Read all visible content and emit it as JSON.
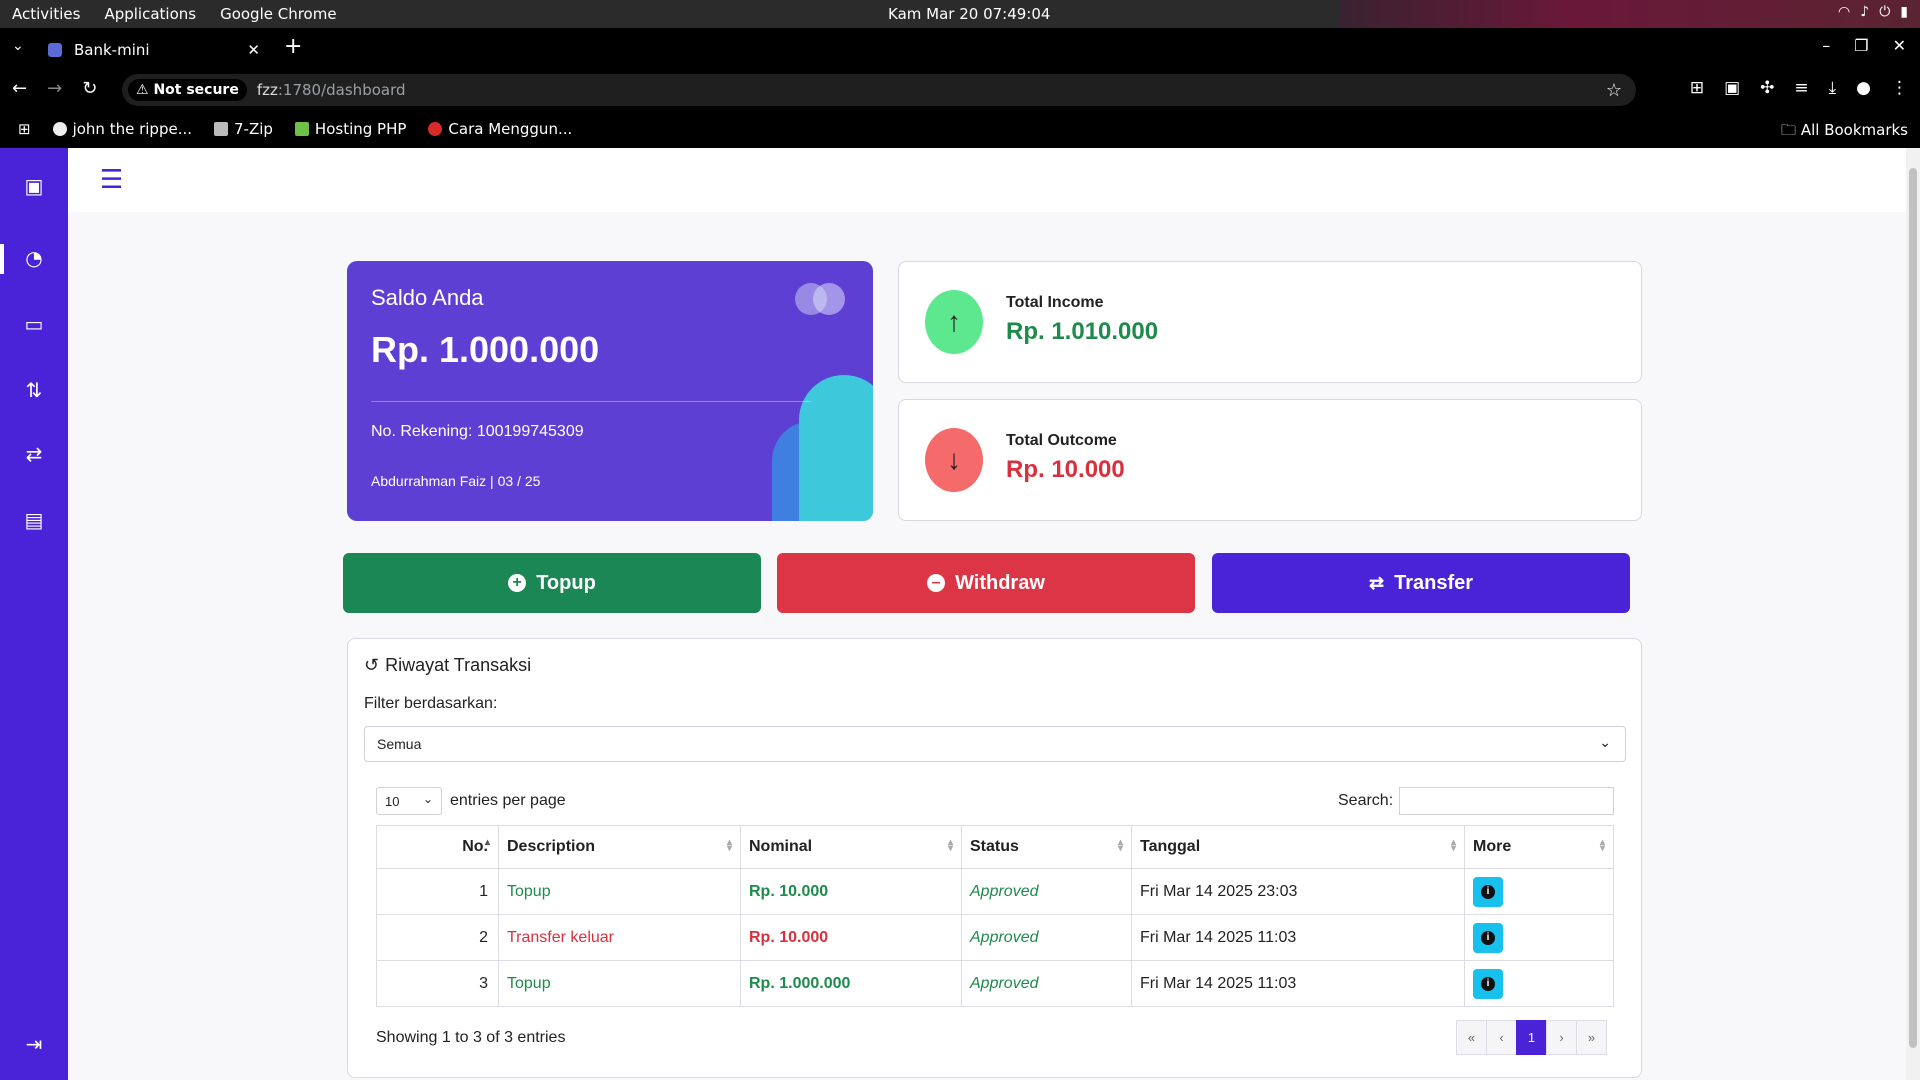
{
  "os": {
    "activities": "Activities",
    "applications": "Applications",
    "app_name": "Google Chrome",
    "clock": "Kam Mar 20  07:49:04"
  },
  "browser": {
    "tab_title": "Bank-mini",
    "not_secure": "Not secure",
    "url_host": "fzz",
    "url_rest": ":1780/dashboard",
    "bookmarks": [
      "john the rippe...",
      "7-Zip",
      "Hosting PHP",
      "Cara Menggun..."
    ],
    "all_bookmarks": "All Bookmarks"
  },
  "saldo": {
    "title": "Saldo Anda",
    "amount": "Rp. 1.000.000",
    "rekening": "No. Rekening: 100199745309",
    "owner": "Abdurrahman Faiz | 03 / 25"
  },
  "income": {
    "label": "Total Income",
    "value": "Rp. 1.010.000"
  },
  "outcome": {
    "label": "Total Outcome",
    "value": "Rp. 10.000"
  },
  "actions": {
    "topup": "Topup",
    "withdraw": "Withdraw",
    "transfer": "Transfer"
  },
  "colors": {
    "primary": "#4a22d8",
    "topup": "#1b8754",
    "withdraw": "#dc3545",
    "transfer": "#4a22d8",
    "income": "#5de88f",
    "outcome": "#f56b6b"
  },
  "transactions": {
    "title": "Riwayat Transaksi",
    "filter_label": "Filter berdasarkan:",
    "filter_value": "Semua",
    "per_page": "10",
    "per_page_label": "entries per page",
    "search_label": "Search:",
    "columns": [
      "No.",
      "Description",
      "Nominal",
      "Status",
      "Tanggal",
      "More"
    ],
    "rows": [
      {
        "no": "1",
        "desc": "Topup",
        "nominal": "Rp. 10.000",
        "status": "Approved",
        "date": "Fri Mar 14 2025 23:03",
        "type": "in"
      },
      {
        "no": "2",
        "desc": "Transfer keluar",
        "nominal": "Rp. 10.000",
        "status": "Approved",
        "date": "Fri Mar 14 2025 11:03",
        "type": "out"
      },
      {
        "no": "3",
        "desc": "Topup",
        "nominal": "Rp. 1.000.000",
        "status": "Approved",
        "date": "Fri Mar 14 2025 11:03",
        "type": "in"
      }
    ],
    "showing": "Showing 1 to 3 of 3 entries",
    "pager": [
      "«",
      "‹",
      "1",
      "›",
      "»"
    ],
    "current_page": "1"
  }
}
